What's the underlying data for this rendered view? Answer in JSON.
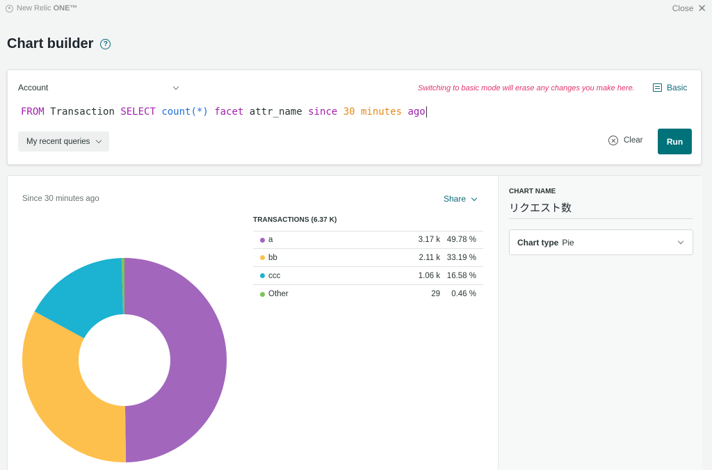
{
  "topbar": {
    "brand_prefix": "New Relic ",
    "brand_bold": "ONE™",
    "close_label": "Close"
  },
  "page": {
    "title": "Chart builder"
  },
  "query": {
    "account_label": "Account",
    "warning": "Switching to basic mode will erase any changes you make here.",
    "basic_label": "Basic",
    "tokens": {
      "from": "FROM",
      "table": "Transaction",
      "select": "SELECT",
      "func": "count(*)",
      "facet": "facet",
      "attr": "attr_name",
      "since": "since",
      "number": "30",
      "unit": "minutes",
      "ago": "ago"
    },
    "recent_label": "My recent queries",
    "clear_label": "Clear",
    "run_label": "Run"
  },
  "results": {
    "since_label": "Since 30 minutes ago",
    "share_label": "Share",
    "legend_title": "TRANSACTIONS (6.37 K)"
  },
  "chart_data": {
    "type": "pie",
    "donut": true,
    "categories": [
      "a",
      "bb",
      "ccc",
      "Other"
    ],
    "values": [
      3170,
      2110,
      1060,
      29
    ],
    "value_labels": [
      "3.17 k",
      "2.11 k",
      "1.06 k",
      "29"
    ],
    "percents": [
      49.78,
      33.19,
      16.58,
      0.46
    ],
    "percent_labels": [
      "49.78 %",
      "33.19 %",
      "16.58 %",
      "0.46 %"
    ],
    "colors": [
      "#a266bd",
      "#fec04d",
      "#1cb2d1",
      "#7cc457"
    ],
    "title": "TRANSACTIONS (6.37 K)",
    "legend": "right"
  },
  "panel": {
    "chart_name_label": "CHART NAME",
    "chart_name": "リクエスト数",
    "chart_type_label": "Chart type",
    "chart_type_value": "Pie"
  }
}
